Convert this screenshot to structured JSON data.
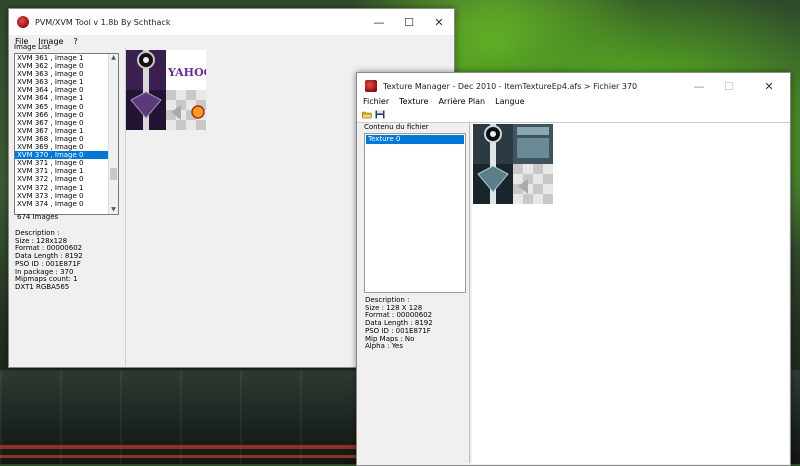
{
  "pvm_window": {
    "title": "PVM/XVM Tool v 1.8b By Schthack",
    "menu": [
      "File",
      "Image",
      "?"
    ],
    "list_label": "Image List",
    "items": [
      "XVM 361 , Image 1",
      "XVM 362 , Image 0",
      "XVM 363 , Image 0",
      "XVM 363 , Image 1",
      "XVM 364 , Image 0",
      "XVM 364 , Image 1",
      "XVM 365 , Image 0",
      "XVM 366 , Image 0",
      "XVM 367 , Image 0",
      "XVM 367 , Image 1",
      "XVM 368 , Image 0",
      "XVM 369 , Image 0",
      "XVM 370 , Image 0",
      "XVM 371 , Image 0",
      "XVM 371 , Image 1",
      "XVM 372 , Image 0",
      "XVM 372 , Image 1",
      "XVM 373 , Image 0",
      "XVM 374 , Image 0"
    ],
    "selected_item": "XVM 370 , Image 0",
    "count_text": "674 Images",
    "description": [
      "Description :",
      "Size : 128x128",
      "Format : 00000602",
      "Data Length : 8192",
      "PSO ID : 001E871F",
      "In package : 370",
      "Mipmaps count: 1",
      "DXT1 RGBA565"
    ],
    "texture_text": "YAHOO!"
  },
  "texture_window": {
    "title": "Texture Manager - Dec 2010 - ItemTextureEp4.afs > Fichier 370",
    "menu": [
      "Fichier",
      "Texture",
      "Arrière Plan",
      "Langue"
    ],
    "toolbar": [
      "open-folder-icon",
      "save-icon"
    ],
    "group_label": "Contenu du fichier",
    "items": [
      "Texture 0"
    ],
    "description": [
      "Description :",
      "Size : 128 X 128",
      "Format : 00000602",
      "Data Length : 8192",
      "PSO ID : 001E871F",
      "Mip Maps : No",
      "Alpha : Yes"
    ]
  },
  "colors": {
    "selection": "#0078d7",
    "window_bg": "#f0f0f0"
  }
}
